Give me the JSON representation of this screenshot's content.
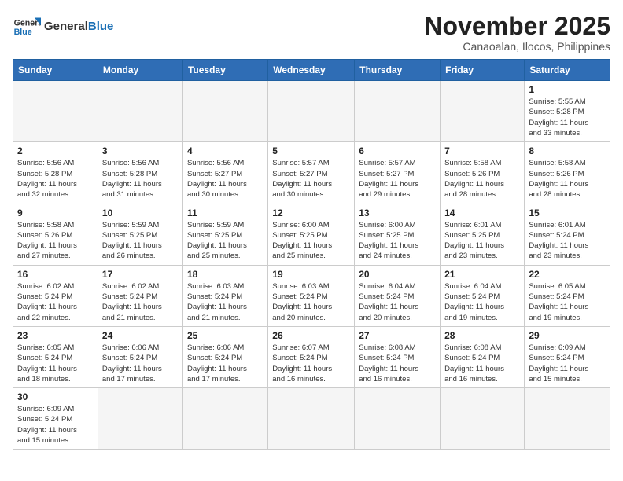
{
  "logo": {
    "text_general": "General",
    "text_blue": "Blue"
  },
  "title": "November 2025",
  "subtitle": "Canaoalan, Ilocos, Philippines",
  "days_header": [
    "Sunday",
    "Monday",
    "Tuesday",
    "Wednesday",
    "Thursday",
    "Friday",
    "Saturday"
  ],
  "weeks": [
    [
      {
        "day": "",
        "info": ""
      },
      {
        "day": "",
        "info": ""
      },
      {
        "day": "",
        "info": ""
      },
      {
        "day": "",
        "info": ""
      },
      {
        "day": "",
        "info": ""
      },
      {
        "day": "",
        "info": ""
      },
      {
        "day": "1",
        "info": "Sunrise: 5:55 AM\nSunset: 5:28 PM\nDaylight: 11 hours\nand 33 minutes."
      }
    ],
    [
      {
        "day": "2",
        "info": "Sunrise: 5:56 AM\nSunset: 5:28 PM\nDaylight: 11 hours\nand 32 minutes."
      },
      {
        "day": "3",
        "info": "Sunrise: 5:56 AM\nSunset: 5:28 PM\nDaylight: 11 hours\nand 31 minutes."
      },
      {
        "day": "4",
        "info": "Sunrise: 5:56 AM\nSunset: 5:27 PM\nDaylight: 11 hours\nand 30 minutes."
      },
      {
        "day": "5",
        "info": "Sunrise: 5:57 AM\nSunset: 5:27 PM\nDaylight: 11 hours\nand 30 minutes."
      },
      {
        "day": "6",
        "info": "Sunrise: 5:57 AM\nSunset: 5:27 PM\nDaylight: 11 hours\nand 29 minutes."
      },
      {
        "day": "7",
        "info": "Sunrise: 5:58 AM\nSunset: 5:26 PM\nDaylight: 11 hours\nand 28 minutes."
      },
      {
        "day": "8",
        "info": "Sunrise: 5:58 AM\nSunset: 5:26 PM\nDaylight: 11 hours\nand 28 minutes."
      }
    ],
    [
      {
        "day": "9",
        "info": "Sunrise: 5:58 AM\nSunset: 5:26 PM\nDaylight: 11 hours\nand 27 minutes."
      },
      {
        "day": "10",
        "info": "Sunrise: 5:59 AM\nSunset: 5:25 PM\nDaylight: 11 hours\nand 26 minutes."
      },
      {
        "day": "11",
        "info": "Sunrise: 5:59 AM\nSunset: 5:25 PM\nDaylight: 11 hours\nand 25 minutes."
      },
      {
        "day": "12",
        "info": "Sunrise: 6:00 AM\nSunset: 5:25 PM\nDaylight: 11 hours\nand 25 minutes."
      },
      {
        "day": "13",
        "info": "Sunrise: 6:00 AM\nSunset: 5:25 PM\nDaylight: 11 hours\nand 24 minutes."
      },
      {
        "day": "14",
        "info": "Sunrise: 6:01 AM\nSunset: 5:25 PM\nDaylight: 11 hours\nand 23 minutes."
      },
      {
        "day": "15",
        "info": "Sunrise: 6:01 AM\nSunset: 5:24 PM\nDaylight: 11 hours\nand 23 minutes."
      }
    ],
    [
      {
        "day": "16",
        "info": "Sunrise: 6:02 AM\nSunset: 5:24 PM\nDaylight: 11 hours\nand 22 minutes."
      },
      {
        "day": "17",
        "info": "Sunrise: 6:02 AM\nSunset: 5:24 PM\nDaylight: 11 hours\nand 21 minutes."
      },
      {
        "day": "18",
        "info": "Sunrise: 6:03 AM\nSunset: 5:24 PM\nDaylight: 11 hours\nand 21 minutes."
      },
      {
        "day": "19",
        "info": "Sunrise: 6:03 AM\nSunset: 5:24 PM\nDaylight: 11 hours\nand 20 minutes."
      },
      {
        "day": "20",
        "info": "Sunrise: 6:04 AM\nSunset: 5:24 PM\nDaylight: 11 hours\nand 20 minutes."
      },
      {
        "day": "21",
        "info": "Sunrise: 6:04 AM\nSunset: 5:24 PM\nDaylight: 11 hours\nand 19 minutes."
      },
      {
        "day": "22",
        "info": "Sunrise: 6:05 AM\nSunset: 5:24 PM\nDaylight: 11 hours\nand 19 minutes."
      }
    ],
    [
      {
        "day": "23",
        "info": "Sunrise: 6:05 AM\nSunset: 5:24 PM\nDaylight: 11 hours\nand 18 minutes."
      },
      {
        "day": "24",
        "info": "Sunrise: 6:06 AM\nSunset: 5:24 PM\nDaylight: 11 hours\nand 17 minutes."
      },
      {
        "day": "25",
        "info": "Sunrise: 6:06 AM\nSunset: 5:24 PM\nDaylight: 11 hours\nand 17 minutes."
      },
      {
        "day": "26",
        "info": "Sunrise: 6:07 AM\nSunset: 5:24 PM\nDaylight: 11 hours\nand 16 minutes."
      },
      {
        "day": "27",
        "info": "Sunrise: 6:08 AM\nSunset: 5:24 PM\nDaylight: 11 hours\nand 16 minutes."
      },
      {
        "day": "28",
        "info": "Sunrise: 6:08 AM\nSunset: 5:24 PM\nDaylight: 11 hours\nand 16 minutes."
      },
      {
        "day": "29",
        "info": "Sunrise: 6:09 AM\nSunset: 5:24 PM\nDaylight: 11 hours\nand 15 minutes."
      }
    ],
    [
      {
        "day": "30",
        "info": "Sunrise: 6:09 AM\nSunset: 5:24 PM\nDaylight: 11 hours\nand 15 minutes."
      },
      {
        "day": "",
        "info": ""
      },
      {
        "day": "",
        "info": ""
      },
      {
        "day": "",
        "info": ""
      },
      {
        "day": "",
        "info": ""
      },
      {
        "day": "",
        "info": ""
      },
      {
        "day": "",
        "info": ""
      }
    ]
  ]
}
